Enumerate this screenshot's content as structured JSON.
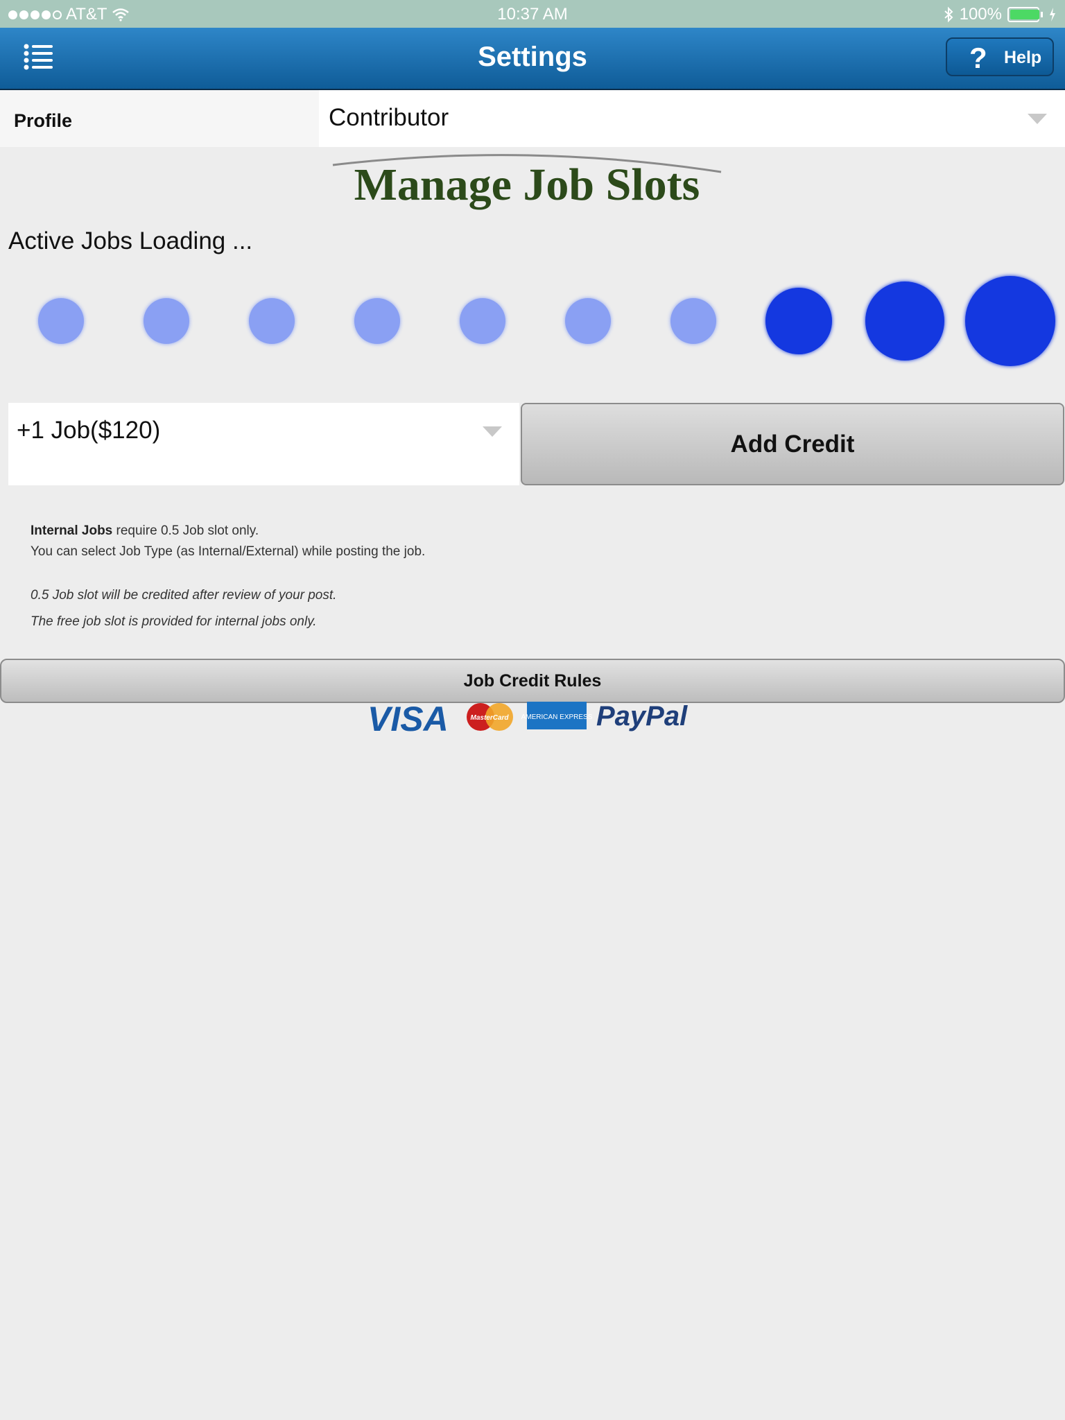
{
  "status_bar": {
    "carrier": "AT&T",
    "time": "10:37 AM",
    "battery": "100%",
    "battery_level": 1.0
  },
  "nav": {
    "title": "Settings",
    "help_label": "Help",
    "help_icon": "question-mark-icon",
    "menu_icon": "list-menu-icon"
  },
  "profile": {
    "label": "Profile",
    "selected": "Contributor"
  },
  "heading_image_text": "Manage Job Slots",
  "active_jobs_text": "Active Jobs Loading ...",
  "credit": {
    "selected_option": "+1 Job($120)",
    "add_button": "Add Credit"
  },
  "info": {
    "line1_bold": "Internal Jobs",
    "line1_rest": " require 0.5 Job slot only.",
    "line2": "You can select Job Type (as Internal/External) while posting the job.",
    "note1": "0.5 Job slot will be credited after review of your post.",
    "note2": "The free job slot is provided for internal jobs only."
  },
  "rules_button": "Job Credit Rules",
  "payment_logos": [
    "VISA",
    "MasterCard",
    "AMERICAN EXPRESS",
    "PayPal"
  ],
  "colors": {
    "status_bar": "#a8c8bc",
    "nav_top": "#2e86c8",
    "nav_bottom": "#0f5c98",
    "loader_light": "#8aa0f3",
    "loader_dark": "#1438e0",
    "heading_green": "#2c4a1a"
  }
}
